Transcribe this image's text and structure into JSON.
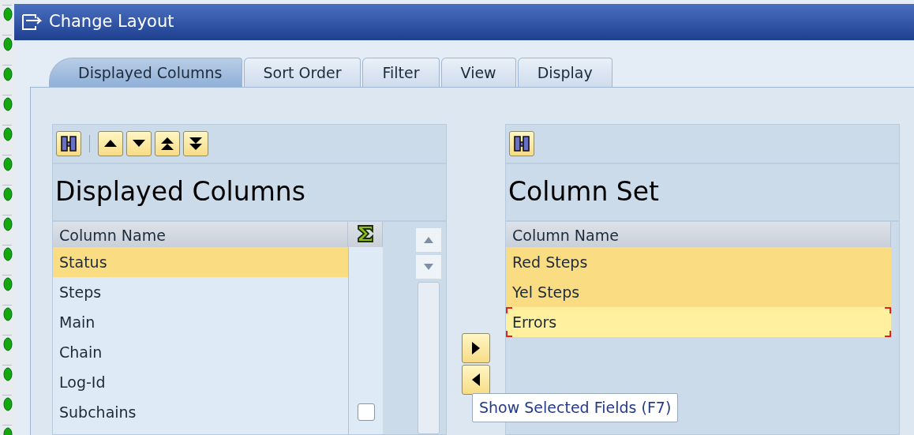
{
  "window": {
    "title": "Change Layout"
  },
  "tabs": [
    {
      "label": "Displayed Columns",
      "selected": true
    },
    {
      "label": "Sort Order",
      "selected": false
    },
    {
      "label": "Filter",
      "selected": false
    },
    {
      "label": "View",
      "selected": false
    },
    {
      "label": "Display",
      "selected": false
    }
  ],
  "displayed_columns": {
    "title": "Displayed Columns",
    "column_header": "Column Name",
    "rows": [
      {
        "label": "Status",
        "selected": true
      },
      {
        "label": "Steps",
        "selected": false
      },
      {
        "label": "Main",
        "selected": false
      },
      {
        "label": "Chain",
        "selected": false
      },
      {
        "label": "Log-Id",
        "selected": false
      },
      {
        "label": "Subchains",
        "selected": false,
        "sum_checked": false
      }
    ]
  },
  "column_set": {
    "title": "Column Set",
    "column_header": "Column Name",
    "rows": [
      {
        "label": "Red Steps",
        "selected": true,
        "focused": false
      },
      {
        "label": "Yel Steps",
        "selected": true,
        "focused": false
      },
      {
        "label": "Errors",
        "selected": false,
        "focused": true
      }
    ]
  },
  "tooltip": "Show Selected Fields (F7)"
}
